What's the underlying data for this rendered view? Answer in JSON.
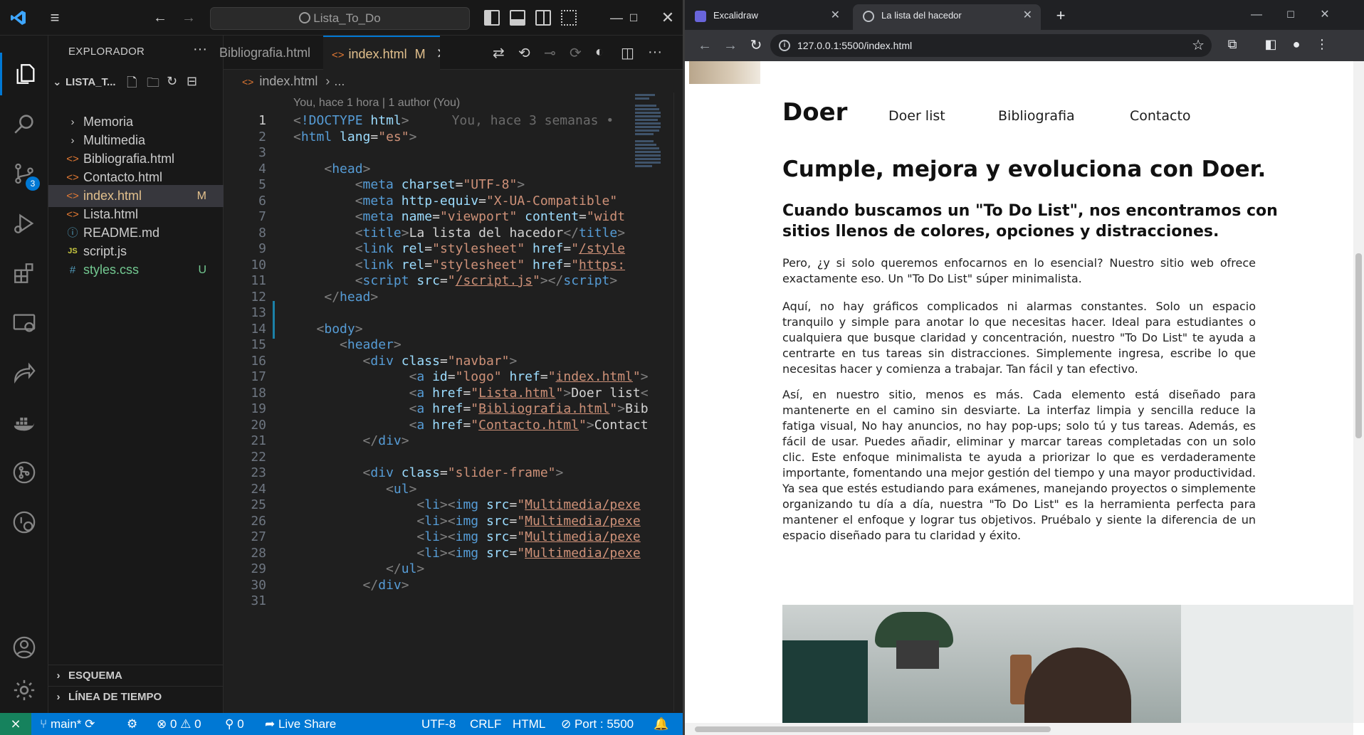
{
  "vscode": {
    "command_center": "Lista_To_Do",
    "explorer": {
      "title": "EXPLORADOR",
      "more": "···",
      "folder": "LISTA_T...",
      "files": [
        {
          "icon": "folder-chevron",
          "name": "Memoria",
          "status": "",
          "color": "#cccccc"
        },
        {
          "icon": "folder-chevron",
          "name": "Multimedia",
          "status": "",
          "color": "#cccccc"
        },
        {
          "icon": "html-file-icon",
          "name": "Bibliografia.html",
          "status": "",
          "color": "#cccccc"
        },
        {
          "icon": "html-file-icon",
          "name": "Contacto.html",
          "status": "",
          "color": "#cccccc"
        },
        {
          "icon": "html-file-icon",
          "name": "index.html",
          "status": "M",
          "color": "#e2c08d"
        },
        {
          "icon": "html-file-icon",
          "name": "Lista.html",
          "status": "",
          "color": "#cccccc"
        },
        {
          "icon": "info-icon",
          "name": "README.md",
          "status": "",
          "color": "#cccccc"
        },
        {
          "icon": "js-file-icon",
          "name": "script.js",
          "status": "",
          "color": "#cccccc"
        },
        {
          "icon": "css-file-icon",
          "name": "styles.css",
          "status": "U",
          "color": "#73c991"
        }
      ],
      "sections": [
        "ESQUEMA",
        "LÍNEA DE TIEMPO"
      ]
    },
    "tabs": [
      {
        "label": "Bibliografia.html",
        "active": false
      },
      {
        "label": "index.html",
        "modified": "M",
        "active": true
      }
    ],
    "breadcrumb": {
      "file": "index.html",
      "rest": "..."
    },
    "blame": "You, hace 1 hora | 1 author (You)",
    "inline_blame": "You, hace 3 semanas •",
    "code_lines": [
      {
        "n": "1",
        "html": "<span class='pun'>&lt;</span><span class='tag'>!DOCTYPE</span> <span class='att'>html</span><span class='pun'>&gt;</span>"
      },
      {
        "n": "2",
        "html": "<span class='pun'>&lt;</span><span class='tag'>html</span> <span class='att'>lang</span><span class='txt'>=</span><span class='str'>\"es\"</span><span class='pun'>&gt;</span>"
      },
      {
        "n": "3",
        "html": ""
      },
      {
        "n": "4",
        "html": "    <span class='pun'>&lt;</span><span class='tag'>head</span><span class='pun'>&gt;</span>"
      },
      {
        "n": "5",
        "html": "        <span class='pun'>&lt;</span><span class='tag'>meta</span> <span class='att'>charset</span><span class='txt'>=</span><span class='str'>\"UTF-8\"</span><span class='pun'>&gt;</span>"
      },
      {
        "n": "6",
        "html": "        <span class='pun'>&lt;</span><span class='tag'>meta</span> <span class='att'>http-equiv</span><span class='txt'>=</span><span class='str'>\"X-UA-Compatible\"</span>"
      },
      {
        "n": "7",
        "html": "        <span class='pun'>&lt;</span><span class='tag'>meta</span> <span class='att'>name</span><span class='txt'>=</span><span class='str'>\"viewport\"</span> <span class='att'>content</span><span class='txt'>=</span><span class='str'>\"widt</span>"
      },
      {
        "n": "8",
        "html": "        <span class='pun'>&lt;</span><span class='tag'>title</span><span class='pun'>&gt;</span><span class='txt'>La lista del hacedor</span><span class='pun'>&lt;/</span><span class='tag'>title</span><span class='pun'>&gt;</span>"
      },
      {
        "n": "9",
        "html": "        <span class='pun'>&lt;</span><span class='tag'>link</span> <span class='att'>rel</span><span class='txt'>=</span><span class='str'>\"stylesheet\"</span> <span class='att'>href</span><span class='txt'>=</span><span class='str'>\"<span class='lnk'>/style</span></span>"
      },
      {
        "n": "10",
        "html": "        <span class='pun'>&lt;</span><span class='tag'>link</span> <span class='att'>rel</span><span class='txt'>=</span><span class='str'>\"stylesheet\"</span> <span class='att'>href</span><span class='txt'>=</span><span class='str'>\"<span class='lnk'>https:</span></span>"
      },
      {
        "n": "11",
        "html": "        <span class='pun'>&lt;</span><span class='tag'>script</span> <span class='att'>src</span><span class='txt'>=</span><span class='str'>\"<span class='lnk'>/script.js</span>\"</span><span class='pun'>&gt;&lt;/</span><span class='tag'>script</span><span class='pun'>&gt;</span>"
      },
      {
        "n": "12",
        "html": "    <span class='pun'>&lt;/</span><span class='tag'>head</span><span class='pun'>&gt;</span>"
      },
      {
        "n": "13",
        "html": ""
      },
      {
        "n": "14",
        "html": "   <span class='pun'>&lt;</span><span class='tag'>body</span><span class='pun'>&gt;</span>"
      },
      {
        "n": "15",
        "html": "      <span class='pun'>&lt;</span><span class='tag'>header</span><span class='pun'>&gt;</span>"
      },
      {
        "n": "16",
        "html": "         <span class='pun'>&lt;</span><span class='tag'>div</span> <span class='att'>class</span><span class='txt'>=</span><span class='str'>\"navbar\"</span><span class='pun'>&gt;</span>"
      },
      {
        "n": "17",
        "html": "               <span class='pun'>&lt;</span><span class='tag'>a</span> <span class='att'>id</span><span class='txt'>=</span><span class='str'>\"logo\"</span> <span class='att'>href</span><span class='txt'>=</span><span class='str'>\"<span class='lnk'>index.html</span>\"</span><span class='pun'>&gt;</span>"
      },
      {
        "n": "18",
        "html": "               <span class='pun'>&lt;</span><span class='tag'>a</span> <span class='att'>href</span><span class='txt'>=</span><span class='str'>\"<span class='lnk'>Lista.html</span>\"</span><span class='pun'>&gt;</span><span class='txt'>Doer list</span><span class='pun'>&lt;</span>"
      },
      {
        "n": "19",
        "html": "               <span class='pun'>&lt;</span><span class='tag'>a</span> <span class='att'>href</span><span class='txt'>=</span><span class='str'>\"<span class='lnk'>Bibliografia.html</span>\"</span><span class='pun'>&gt;</span><span class='txt'>Bib</span>"
      },
      {
        "n": "20",
        "html": "               <span class='pun'>&lt;</span><span class='tag'>a</span> <span class='att'>href</span><span class='txt'>=</span><span class='str'>\"<span class='lnk'>Contacto.html</span>\"</span><span class='pun'>&gt;</span><span class='txt'>Contact</span>"
      },
      {
        "n": "21",
        "html": "         <span class='pun'>&lt;/</span><span class='tag'>div</span><span class='pun'>&gt;</span>"
      },
      {
        "n": "22",
        "html": ""
      },
      {
        "n": "23",
        "html": "         <span class='pun'>&lt;</span><span class='tag'>div</span> <span class='att'>class</span><span class='txt'>=</span><span class='str'>\"slider-frame\"</span><span class='pun'>&gt;</span>"
      },
      {
        "n": "24",
        "html": "            <span class='pun'>&lt;</span><span class='tag'>ul</span><span class='pun'>&gt;</span>"
      },
      {
        "n": "25",
        "html": "                <span class='pun'>&lt;</span><span class='tag'>li</span><span class='pun'>&gt;&lt;</span><span class='tag'>img</span> <span class='att'>src</span><span class='txt'>=</span><span class='str'>\"<span class='lnk'>Multimedia/pexe</span></span>"
      },
      {
        "n": "26",
        "html": "                <span class='pun'>&lt;</span><span class='tag'>li</span><span class='pun'>&gt;&lt;</span><span class='tag'>img</span> <span class='att'>src</span><span class='txt'>=</span><span class='str'>\"<span class='lnk'>Multimedia/pexe</span></span>"
      },
      {
        "n": "27",
        "html": "                <span class='pun'>&lt;</span><span class='tag'>li</span><span class='pun'>&gt;&lt;</span><span class='tag'>img</span> <span class='att'>src</span><span class='txt'>=</span><span class='str'>\"<span class='lnk'>Multimedia/pexe</span></span>"
      },
      {
        "n": "28",
        "html": "                <span class='pun'>&lt;</span><span class='tag'>li</span><span class='pun'>&gt;&lt;</span><span class='tag'>img</span> <span class='att'>src</span><span class='txt'>=</span><span class='str'>\"<span class='lnk'>Multimedia/pexe</span></span>"
      },
      {
        "n": "29",
        "html": "            <span class='pun'>&lt;/</span><span class='tag'>ul</span><span class='pun'>&gt;</span>"
      },
      {
        "n": "30",
        "html": "         <span class='pun'>&lt;/</span><span class='tag'>div</span><span class='pun'>&gt;</span>"
      },
      {
        "n": "31",
        "html": ""
      }
    ],
    "status": {
      "branch": "main*",
      "errors": "0",
      "warnings": "0",
      "ports": "0",
      "liveshare": "Live Share",
      "encoding": "UTF-8",
      "eol": "CRLF",
      "language": "HTML",
      "port": "Port : 5500"
    },
    "source_control_badge": "3"
  },
  "browser": {
    "tabs": [
      {
        "label": "Excalidraw",
        "active": false
      },
      {
        "label": "La lista del hacedor",
        "active": true
      }
    ],
    "url": "127.0.0.1:5500/index.html",
    "page": {
      "logo": "Doer",
      "nav": [
        "Doer list",
        "Bibliografia",
        "Contacto"
      ],
      "h1": "Cumple, mejora y evoluciona con Doer.",
      "h2": "Cuando buscamos un \"To Do List\", nos encontramos con sitios llenos de colores, opciones y distracciones.",
      "paragraphs": [
        "Pero, ¿y si solo queremos enfocarnos en lo esencial? Nuestro sitio web ofrece exactamente eso. Un \"To Do List\" súper minimalista.",
        "Aquí, no hay gráficos complicados ni alarmas constantes. Solo un espacio tranquilo y simple para anotar lo que necesitas hacer. Ideal para estudiantes o cualquiera que busque claridad y concentración, nuestro \"To Do List\" te ayuda a centrarte en tus tareas sin distracciones. Simplemente ingresa, escribe lo que necesitas hacer y comienza a trabajar. Tan fácil y tan efectivo.",
        "Así, en nuestro sitio, menos es más. Cada elemento está diseñado para mantenerte en el camino sin desviarte. La interfaz limpia y sencilla reduce la fatiga visual, No hay anuncios, no hay pop-ups; solo tú y tus tareas. Además, es fácil de usar. Puedes añadir, eliminar y marcar tareas completadas con un solo clic. Este enfoque minimalista te ayuda a priorizar lo que es verdaderamente importante, fomentando una mejor gestión del tiempo y una mayor productividad. Ya sea que estés estudiando para exámenes, manejando proyectos o simplemente organizando tu día a día, nuestra \"To Do List\" es la herramienta perfecta para mantener el enfoque y lograr tus objetivos. Pruébalo y siente la diferencia de un espacio diseñado para tu claridad y éxito."
      ]
    }
  }
}
